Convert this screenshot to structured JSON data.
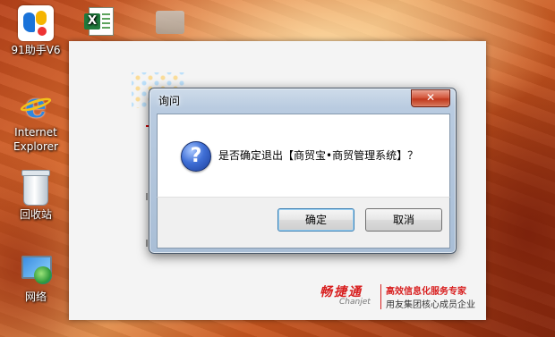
{
  "desktop": {
    "icons": [
      {
        "id": "91zhushou",
        "label": "91助手V6",
        "icon": "91-assistant-icon"
      },
      {
        "id": "ie",
        "label_line1": "Internet",
        "label_line2": "Explorer",
        "icon": "internet-explorer-icon"
      },
      {
        "id": "recycle",
        "label": "回收站",
        "icon": "recycle-bin-icon"
      },
      {
        "id": "network",
        "label": "网络",
        "icon": "network-icon"
      }
    ],
    "top_icons": [
      {
        "id": "excel",
        "icon": "excel-file-icon",
        "glyph": "X"
      },
      {
        "id": "folder",
        "icon": "folder-icon"
      }
    ]
  },
  "app_window": {
    "brand": {
      "logo_cn": "畅捷通",
      "logo_en": "Chanjet",
      "slogan_line1": "高效信息化服务专家",
      "slogan_line2": "用友集团核心成员企业",
      "color": "#d81e1e"
    }
  },
  "dialog": {
    "title": "询问",
    "close_glyph": "✕",
    "icon": "question-icon",
    "icon_glyph": "?",
    "message": "是否确定退出【商贸宝•商贸管理系统】？",
    "buttons": {
      "ok": "确定",
      "cancel": "取消"
    }
  }
}
